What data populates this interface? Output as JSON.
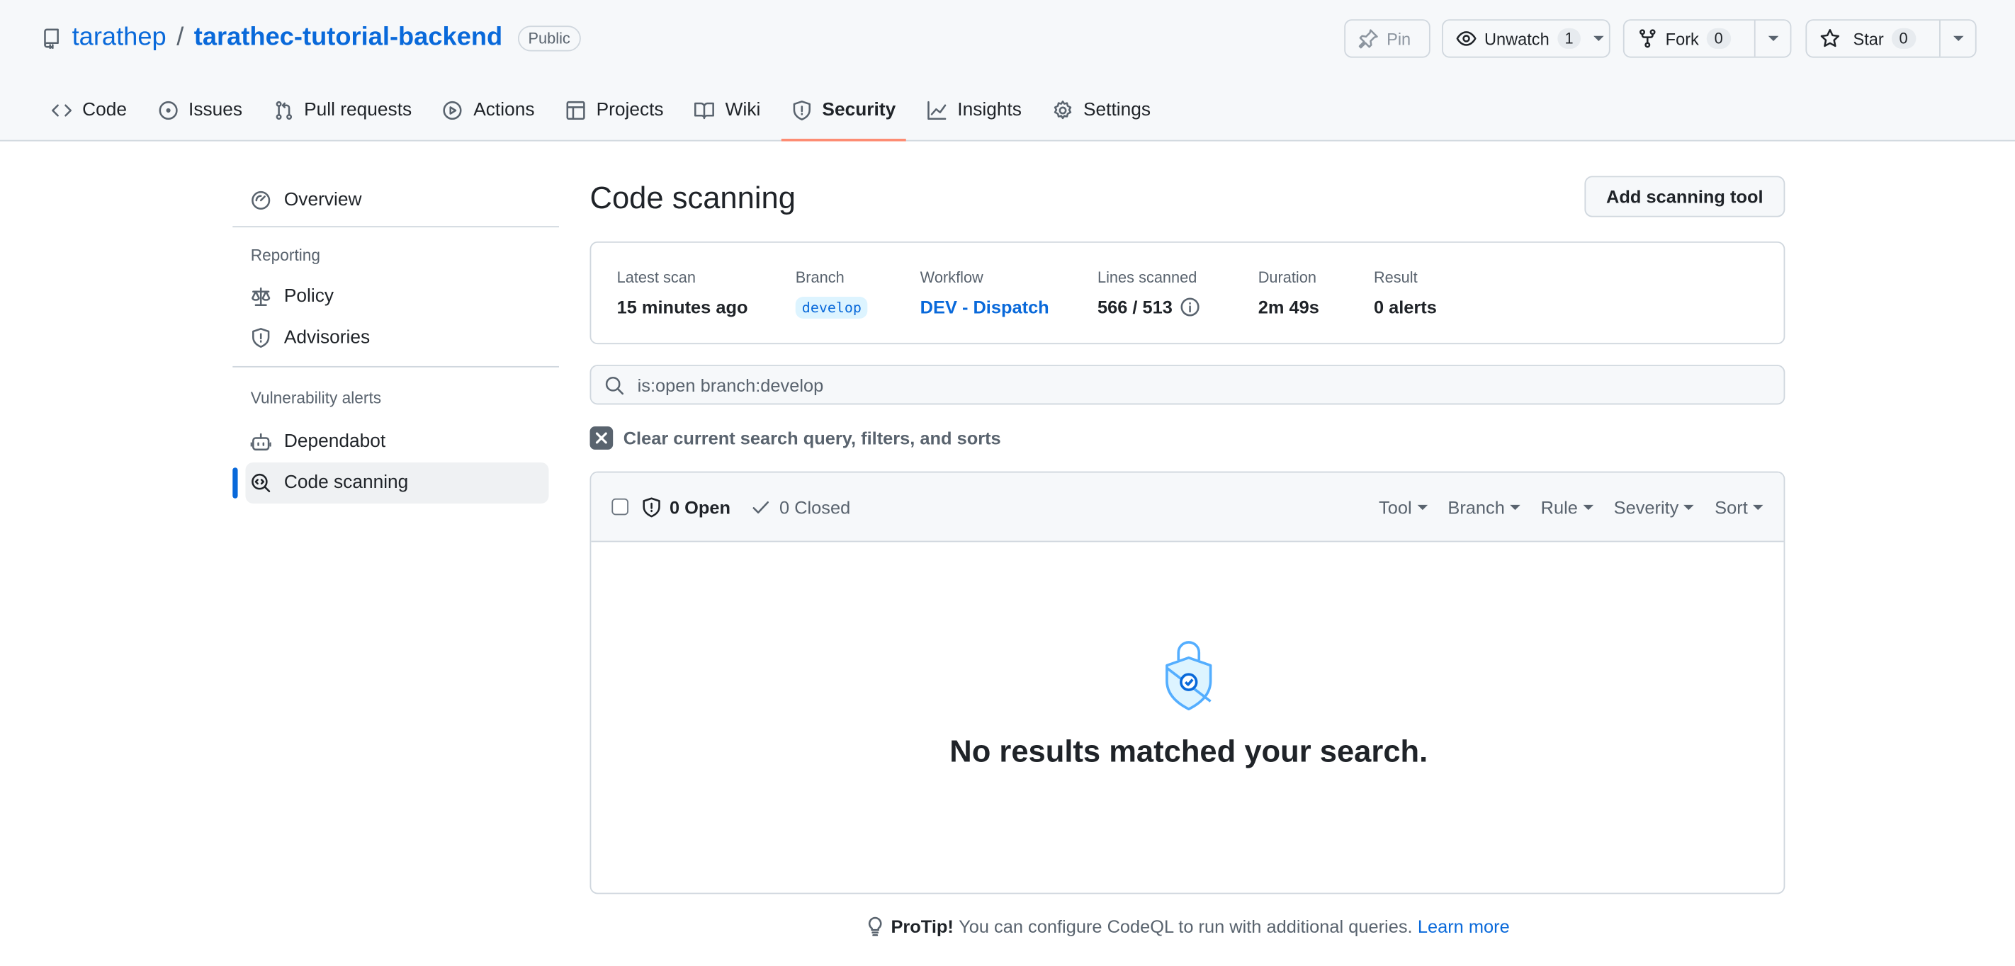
{
  "repo": {
    "owner": "tarathep",
    "separator": "/",
    "name": "tarathec-tutorial-backend",
    "visibility": "Public"
  },
  "header_buttons": {
    "pin": "Pin",
    "unwatch": "Unwatch",
    "unwatch_count": "1",
    "fork": "Fork",
    "fork_count": "0",
    "star": "Star",
    "star_count": "0"
  },
  "tabs": [
    {
      "label": "Code",
      "icon": "code-icon"
    },
    {
      "label": "Issues",
      "icon": "issue-icon"
    },
    {
      "label": "Pull requests",
      "icon": "pull-request-icon"
    },
    {
      "label": "Actions",
      "icon": "play-icon"
    },
    {
      "label": "Projects",
      "icon": "table-icon"
    },
    {
      "label": "Wiki",
      "icon": "book-icon"
    },
    {
      "label": "Security",
      "icon": "shield-icon",
      "active": true
    },
    {
      "label": "Insights",
      "icon": "graph-icon"
    },
    {
      "label": "Settings",
      "icon": "gear-icon"
    }
  ],
  "sidebar": {
    "overview": "Overview",
    "reporting_heading": "Reporting",
    "policy": "Policy",
    "advisories": "Advisories",
    "vuln_heading": "Vulnerability alerts",
    "dependabot": "Dependabot",
    "code_scanning": "Code scanning"
  },
  "main": {
    "title": "Code scanning",
    "add_tool": "Add scanning tool",
    "scan": {
      "latest_label": "Latest scan",
      "latest_value": "15 minutes ago",
      "branch_label": "Branch",
      "branch_value": "develop",
      "workflow_label": "Workflow",
      "workflow_value": "DEV - Dispatch",
      "lines_label": "Lines scanned",
      "lines_value": "566 / 513",
      "duration_label": "Duration",
      "duration_value": "2m 49s",
      "result_label": "Result",
      "result_value": "0 alerts"
    },
    "search_value": "is:open branch:develop",
    "clear_text": "Clear current search query, filters, and sorts",
    "open_label": "0 Open",
    "closed_label": "0 Closed",
    "filters": {
      "tool": "Tool",
      "branch": "Branch",
      "rule": "Rule",
      "severity": "Severity",
      "sort": "Sort"
    },
    "empty_text": "No results matched your search.",
    "protip_lead": "ProTip!",
    "protip_text": "You can configure CodeQL to run with additional queries.",
    "protip_link": "Learn more"
  },
  "colors": {
    "accent": "#0969da",
    "active_tab_underline": "#fd8c73",
    "empty_icon": "#54aeff"
  }
}
